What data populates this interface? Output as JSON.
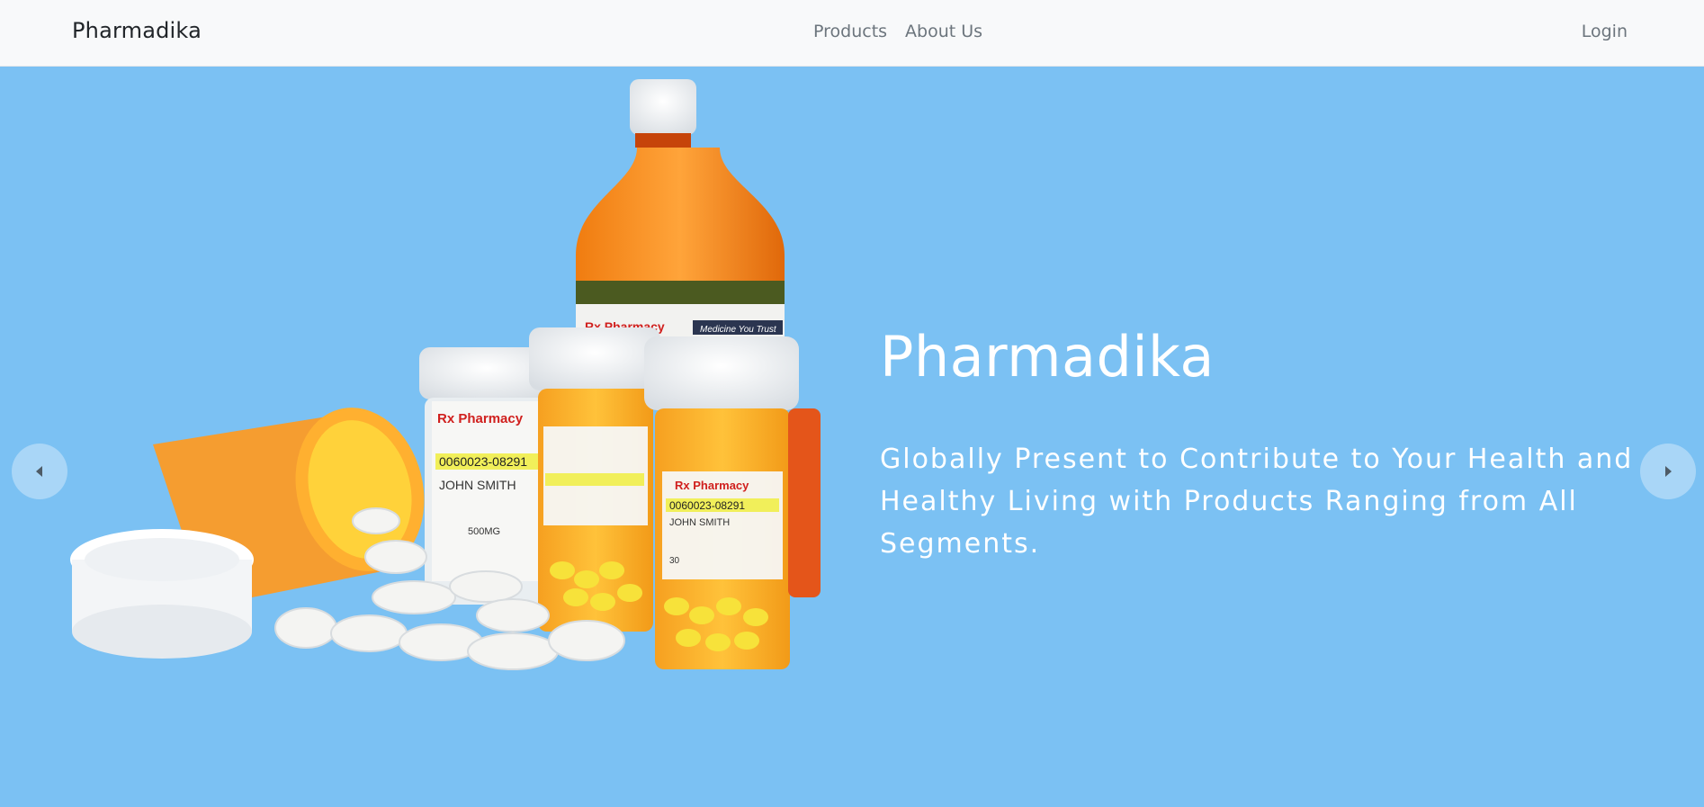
{
  "navbar": {
    "brand": "Pharmadika",
    "links": [
      "Products",
      "About Us"
    ],
    "login": "Login"
  },
  "hero": {
    "title": "Pharmadika",
    "subtitle": "Globally Present to Contribute to Your Health and Healthy Living with Products Ranging from All Segments.",
    "image_description_icon": "pill-bottles-image",
    "background_color": "#7bc1f3"
  },
  "carousel": {
    "prev_icon": "chevron-left-icon",
    "next_icon": "chevron-right-icon"
  },
  "image_labels": {
    "pharmacy": "Rx Pharmacy",
    "tagline": "Medicine You Trust",
    "rx_number": "0060023-08291",
    "patient": "JOHN SMITH",
    "dose": "500MG",
    "qty": "30"
  }
}
